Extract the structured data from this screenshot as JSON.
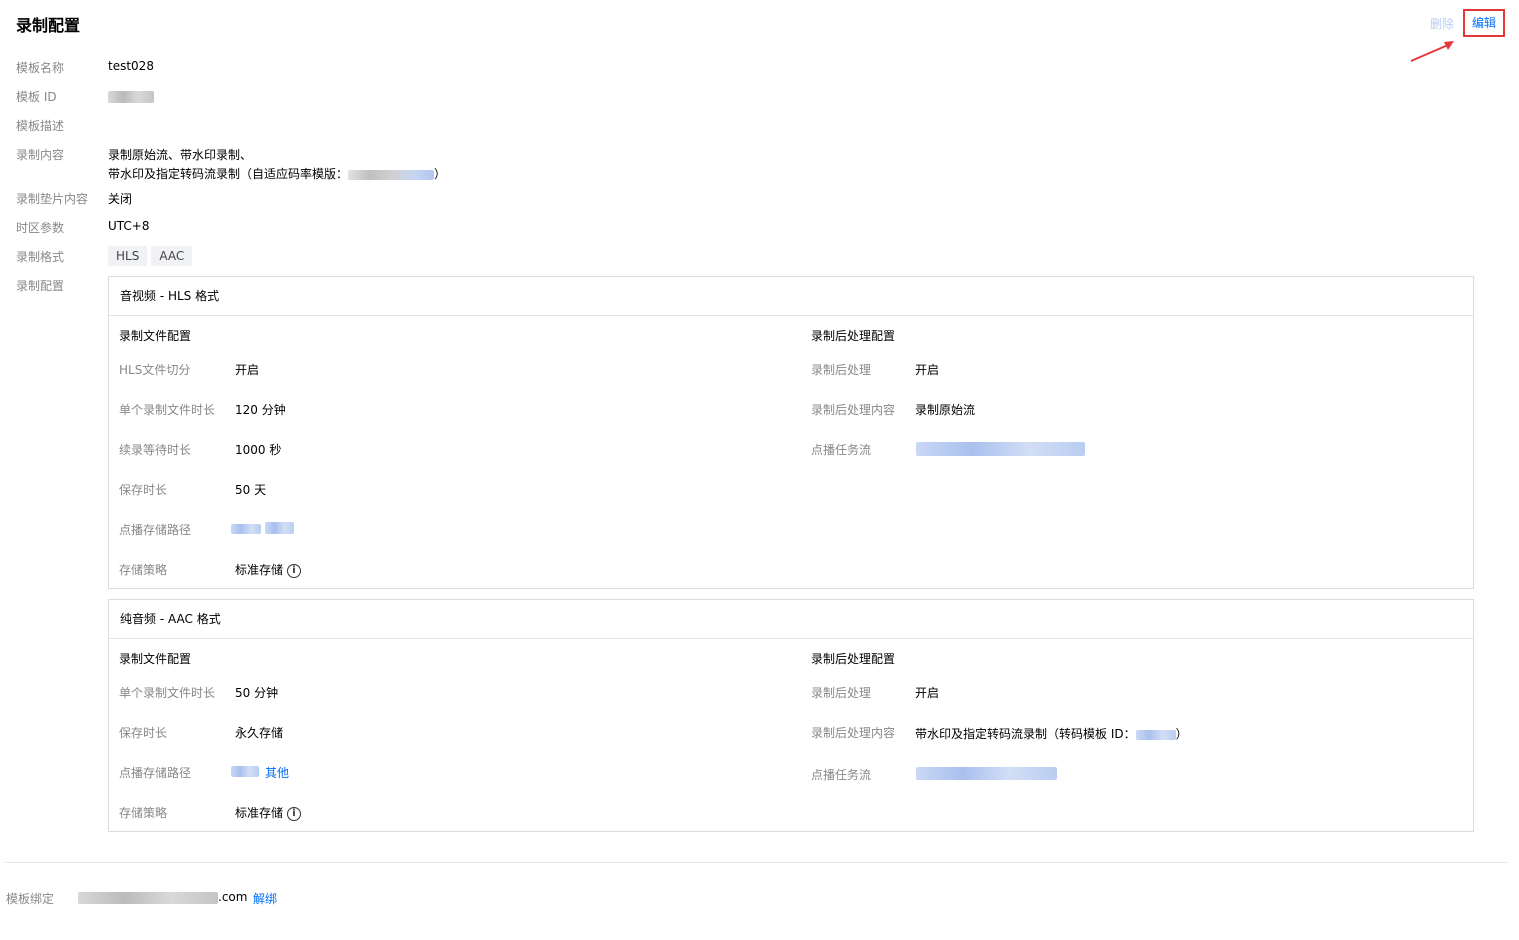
{
  "header": {
    "title": "录制配置",
    "delete_label": "删除",
    "edit_label": "编辑"
  },
  "fields": {
    "name_label": "模板名称",
    "name_value": "test028",
    "id_label": "模板 ID",
    "desc_label": "模板描述",
    "content_label": "录制内容",
    "content_line1": "录制原始流、带水印录制、",
    "content_line2": "带水印及指定转码流录制（自适应码率模版：",
    "content_line2_end": "）",
    "slate_label": "录制垫片内容",
    "slate_value": "关闭",
    "tz_label": "时区参数",
    "tz_value": "UTC+8",
    "format_label": "录制格式",
    "formats": [
      "HLS",
      "AAC"
    ],
    "config_label": "录制配置"
  },
  "hls": {
    "title": "音视频 - HLS 格式",
    "left_heading": "录制文件配置",
    "right_heading": "录制后处理配置",
    "left": [
      {
        "label": "HLS文件切分",
        "value": "开启"
      },
      {
        "label": "单个录制文件时长",
        "value": "120 分钟"
      },
      {
        "label": "续录等待时长",
        "value": "1000 秒"
      },
      {
        "label": "保存时长",
        "value": "50 天"
      },
      {
        "label": "点播存储路径",
        "value": ""
      },
      {
        "label": "存储策略",
        "value": "标准存储"
      }
    ],
    "right": [
      {
        "label": "录制后处理",
        "value": "开启"
      },
      {
        "label": "录制后处理内容",
        "value": "录制原始流"
      },
      {
        "label": "点播任务流",
        "value": ""
      }
    ]
  },
  "aac": {
    "title": "纯音频 - AAC 格式",
    "left_heading": "录制文件配置",
    "right_heading": "录制后处理配置",
    "left": [
      {
        "label": "单个录制文件时长",
        "value": "50 分钟"
      },
      {
        "label": "保存时长",
        "value": "永久存储"
      },
      {
        "label": "点播存储路径",
        "value": "其他"
      },
      {
        "label": "存储策略",
        "value": "标准存储"
      }
    ],
    "right": [
      {
        "label": "录制后处理",
        "value": "开启"
      },
      {
        "label": "录制后处理内容",
        "value": "带水印及指定转码流录制（转码模板 ID：",
        "value_end": "）"
      },
      {
        "label": "点播任务流",
        "value": ""
      }
    ]
  },
  "binding": {
    "label": "模板绑定",
    "domain_suffix": ".com",
    "unbind_label": "解绑"
  },
  "icons": {
    "info": "info-circle-icon",
    "arrow": "red-arrow-icon"
  },
  "colors": {
    "link": "#006eff",
    "highlight": "#e5373b",
    "arrow": "#e5373b"
  }
}
